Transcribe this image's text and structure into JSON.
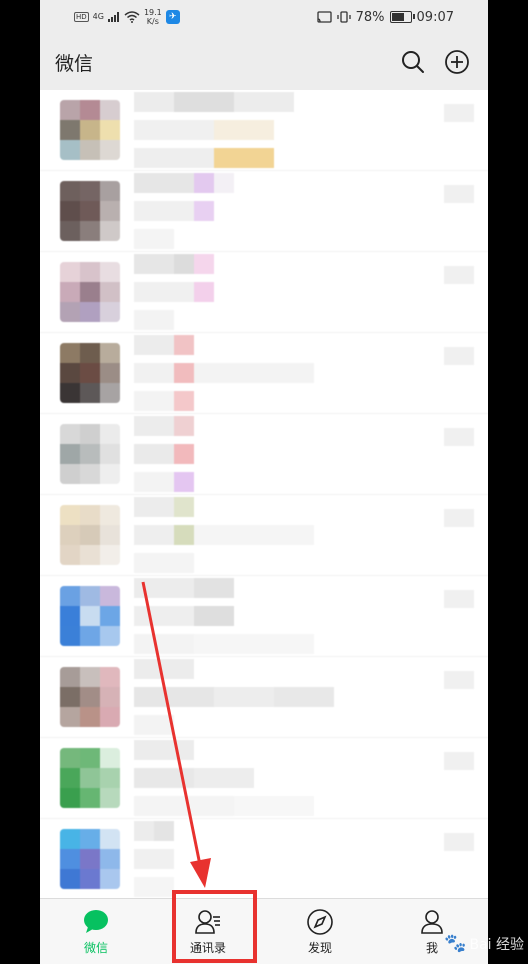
{
  "status_bar": {
    "hd": "HD",
    "network": "4G",
    "speed_value": "19.1",
    "speed_unit": "K/s",
    "battery_percent": "78%",
    "battery_level": 0.78,
    "time": "09:07"
  },
  "header": {
    "title": "微信"
  },
  "tabs": [
    {
      "label": "微信",
      "icon": "chat-bubble-icon",
      "active": true
    },
    {
      "label": "通讯录",
      "icon": "contacts-icon",
      "active": false
    },
    {
      "label": "发现",
      "icon": "compass-icon",
      "active": false
    },
    {
      "label": "我",
      "icon": "person-icon",
      "active": false
    }
  ],
  "watermark": {
    "text": "Bai 经验"
  },
  "colors": {
    "accent": "#07c160",
    "annotation": "#e8322f"
  }
}
